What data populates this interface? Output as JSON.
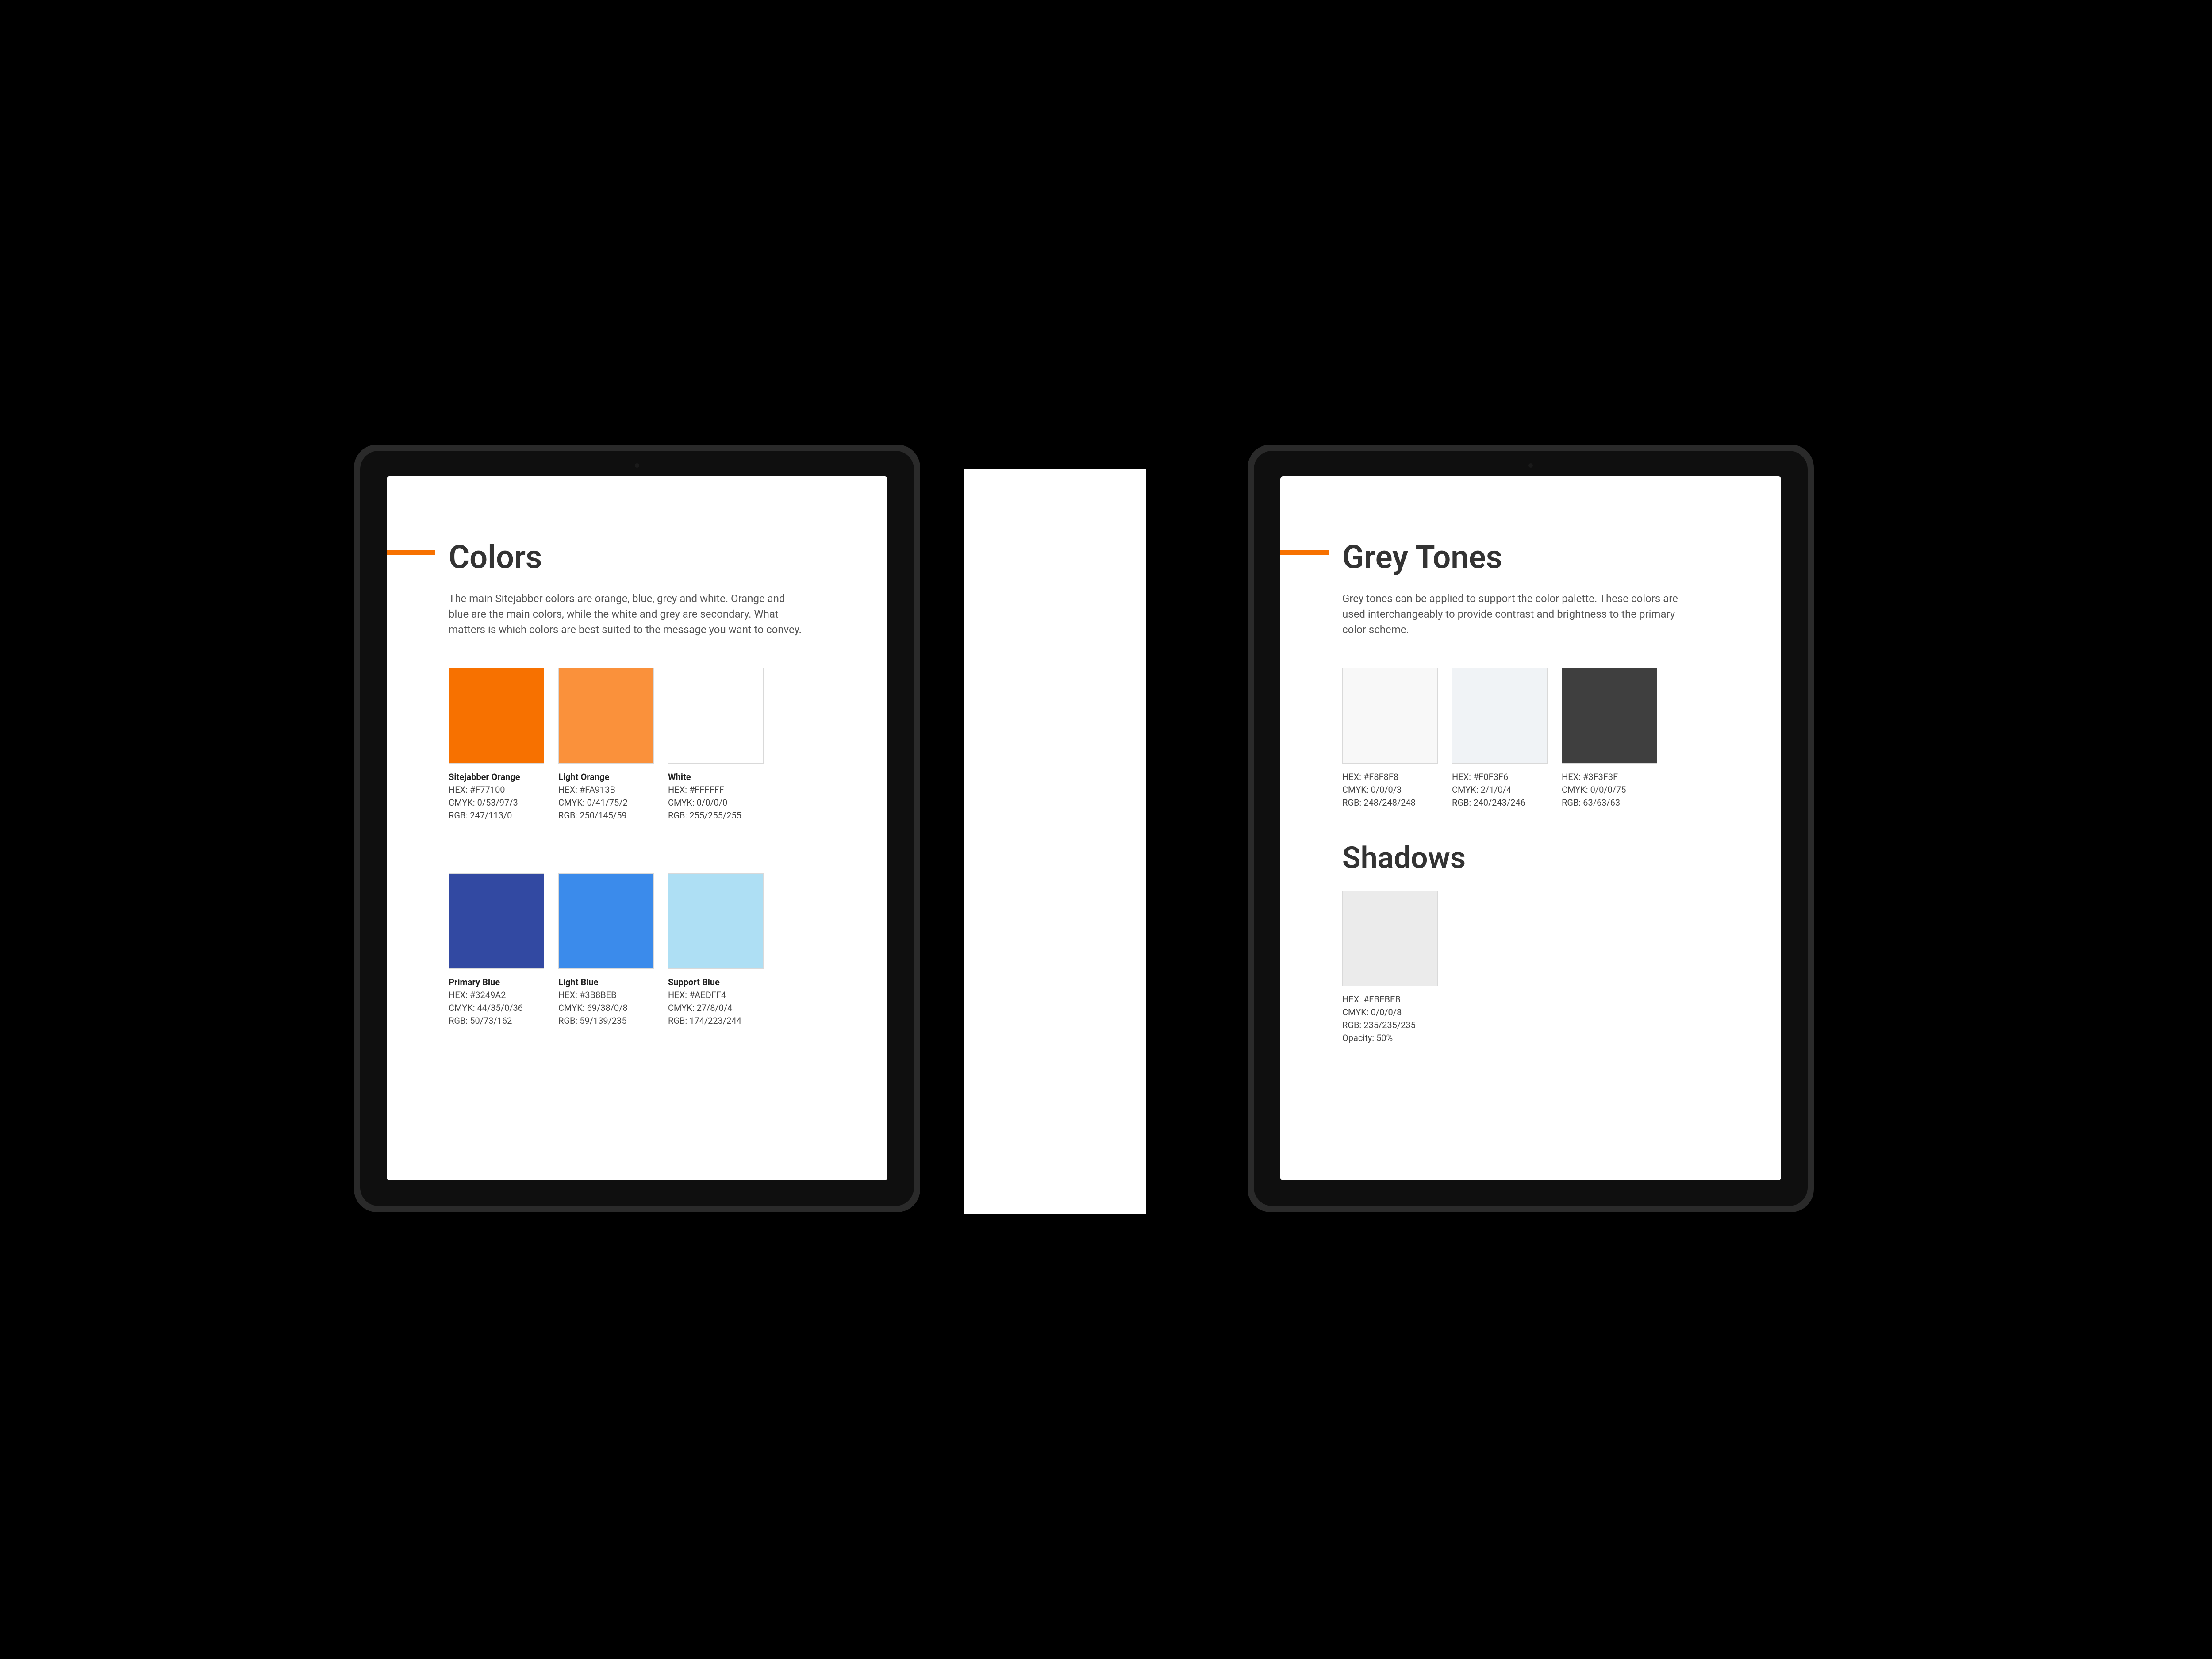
{
  "accent": "#f77100",
  "left": {
    "title": "Colors",
    "lead": "The main Sitejabber colors are orange, blue, grey and white. Orange and blue are the main colors, while the white and grey are secondary. What matters is which colors are best suited to the message you want to convey.",
    "swatches": [
      {
        "name": "Sitejabber Orange",
        "hex": "HEX: #F77100",
        "cmyk": "CMYK: 0/53/97/3",
        "rgb": "RGB: 247/113/0",
        "color": "#F77100"
      },
      {
        "name": "Light Orange",
        "hex": "HEX: #FA913B",
        "cmyk": "CMYK: 0/41/75/2",
        "rgb": "RGB: 250/145/59",
        "color": "#FA913B"
      },
      {
        "name": "White",
        "hex": "HEX: #FFFFFF",
        "cmyk": "CMYK: 0/0/0/0",
        "rgb": "RGB: 255/255/255",
        "color": "#FFFFFF"
      },
      {
        "name": "Primary Blue",
        "hex": "HEX: #3249A2",
        "cmyk": "CMYK: 44/35/0/36",
        "rgb": "RGB: 50/73/162",
        "color": "#3249A2"
      },
      {
        "name": "Light Blue",
        "hex": "HEX: #3B8BEB",
        "cmyk": "CMYK: 69/38/0/8",
        "rgb": "RGB: 59/139/235",
        "color": "#3B8BEB"
      },
      {
        "name": "Support Blue",
        "hex": "HEX: #AEDFF4",
        "cmyk": "CMYK: 27/8/0/4",
        "rgb": "RGB: 174/223/244",
        "color": "#AEDFF4"
      }
    ]
  },
  "right": {
    "title": "Grey Tones",
    "lead": "Grey tones can be applied to support the color palette. These colors are used interchangeably to provide contrast and brightness to the primary color scheme.",
    "swatches": [
      {
        "hex": "HEX: #F8F8F8",
        "cmyk": "CMYK: 0/0/0/3",
        "rgb": "RGB: 248/248/248",
        "color": "#F8F8F8"
      },
      {
        "hex": "HEX: #F0F3F6",
        "cmyk": "CMYK: 2/1/0/4",
        "rgb": "RGB: 240/243/246",
        "color": "#F0F3F6"
      },
      {
        "hex": "HEX: #3F3F3F",
        "cmyk": "CMYK: 0/0/0/75",
        "rgb": "RGB: 63/63/63",
        "color": "#3F3F3F"
      }
    ],
    "shadows_title": "Shadows",
    "shadow_swatch": {
      "hex": "HEX: #EBEBEB",
      "cmyk": "CMYK: 0/0/0/8",
      "rgb": "RGB: 235/235/235",
      "opacity": "Opacity: 50%",
      "color": "#EBEBEB"
    }
  }
}
